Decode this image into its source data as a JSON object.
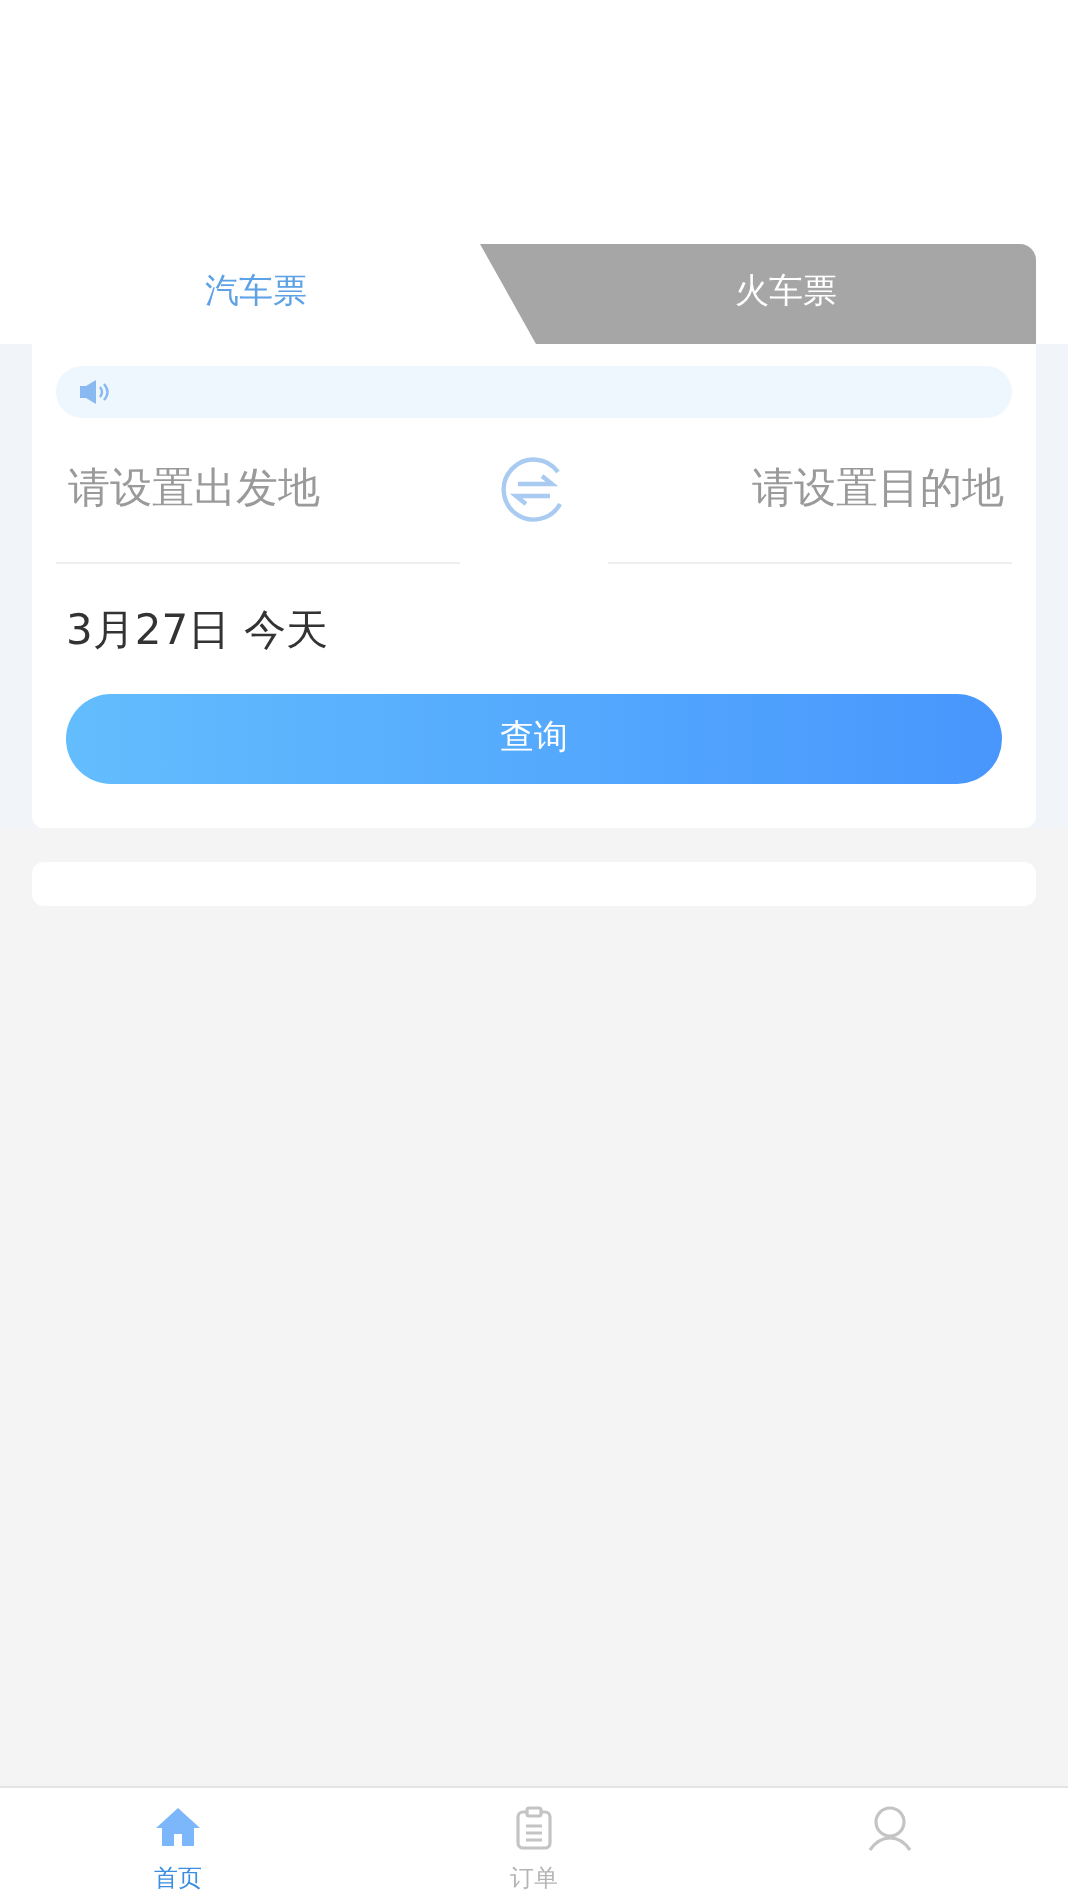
{
  "tabs": [
    {
      "label": "汽车票",
      "selected": true
    },
    {
      "label": "火车票",
      "selected": false
    }
  ],
  "route": {
    "from_placeholder": "请设置出发地",
    "to_placeholder": "请设置目的地"
  },
  "date": "3月27日 今天",
  "search_button": "查询",
  "bottom_nav": [
    {
      "kind": "home",
      "label": "首页",
      "selected": true
    },
    {
      "kind": "orders",
      "label": "订单",
      "selected": false
    },
    {
      "kind": "profile",
      "selected": false
    }
  ]
}
